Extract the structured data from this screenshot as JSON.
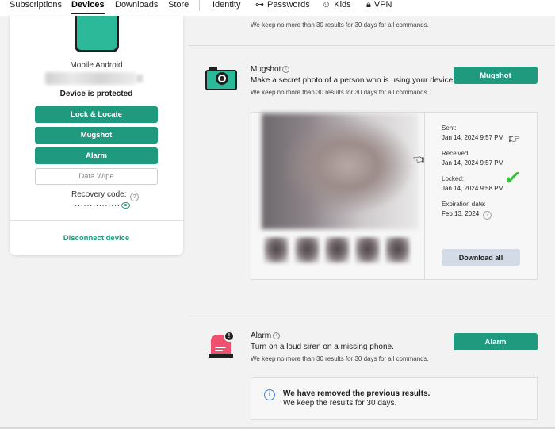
{
  "nav": {
    "items": [
      {
        "label": "Subscriptions",
        "active": false
      },
      {
        "label": "Devices",
        "active": true
      },
      {
        "label": "Downloads",
        "active": false
      },
      {
        "label": "Store",
        "active": false
      }
    ],
    "secondary": [
      {
        "label": "Identity",
        "icon": ""
      },
      {
        "label": "Passwords",
        "icon": "key-icon"
      },
      {
        "label": "Kids",
        "icon": "kids-icon"
      },
      {
        "label": "VPN",
        "icon": "vpn-lock-icon"
      }
    ]
  },
  "device": {
    "type": "Mobile Android",
    "status": "Device is protected",
    "buttons": {
      "lock_locate": "Lock & Locate",
      "mugshot": "Mugshot",
      "alarm": "Alarm",
      "data_wipe": "Data Wipe"
    },
    "recovery_label": "Recovery code:",
    "recovery_masked": "···············",
    "disconnect": "Disconnect device",
    "help_glyph": "?"
  },
  "top_note": "We keep no more than 30 results for 30 days for all commands.",
  "mugshot": {
    "title": "Mugshot",
    "description": "Make a secret photo of a person who is using your device.",
    "note": "We keep no more than 30 results for 30 days for all commands.",
    "button": "Mugshot",
    "info_glyph": "i",
    "details": {
      "sent_label": "Sent:",
      "sent_value": "Jan 14, 2024   9:57 PM",
      "received_label": "Received:",
      "received_value": "Jan 14, 2024   9:57 PM",
      "locked_label": "Locked:",
      "locked_value": "Jan 14, 2024   9:58 PM",
      "expiration_label": "Expiration date:",
      "expiration_value": "Feb 13, 2024"
    },
    "download_all": "Download all"
  },
  "alarm": {
    "title": "Alarm",
    "description": "Turn on a loud siren on a missing phone.",
    "note": "We keep no more than 30 results for 30 days for all commands.",
    "button": "Alarm",
    "badge_glyph": "!",
    "info_glyph": "i"
  },
  "notice": {
    "icon_glyph": "i",
    "title": "We have removed the previous results.",
    "text": "We keep the results for 30 days."
  },
  "colors": {
    "accent": "#1f9a7f",
    "phone": "#2cb99a",
    "alarm": "#f0506e",
    "check": "#36c23a",
    "info": "#3d7fd9"
  }
}
